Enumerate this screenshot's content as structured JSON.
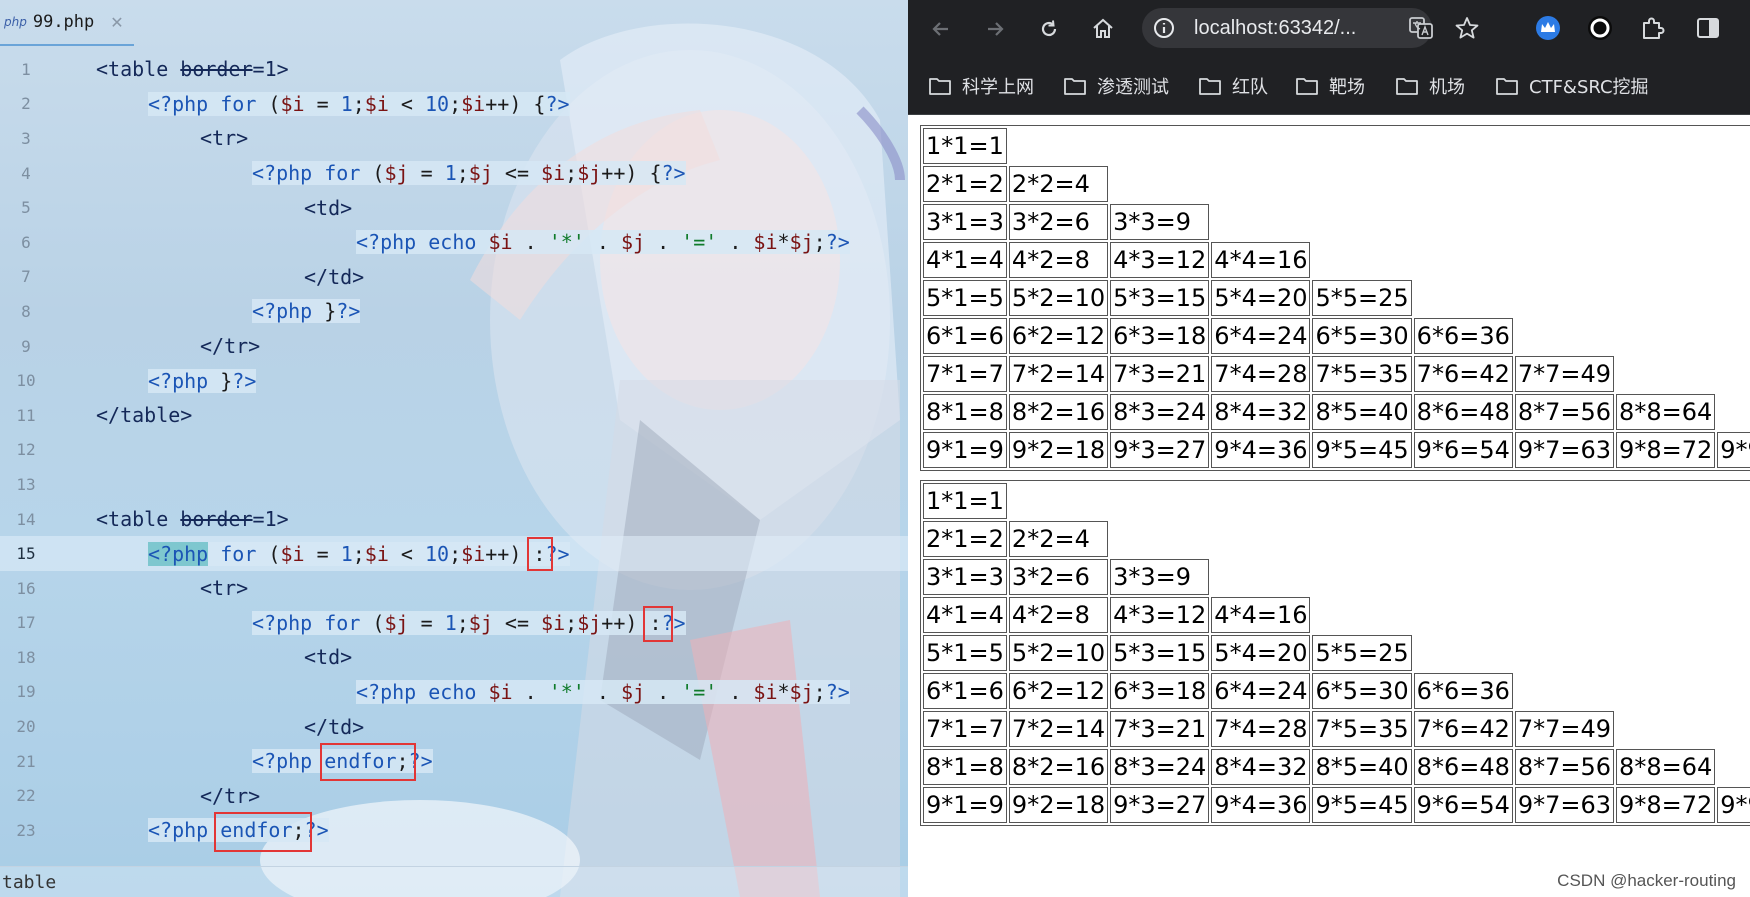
{
  "editor": {
    "file_icon": "php",
    "tab_name": "99.php",
    "close_glyph": "✕",
    "breadcrumb": "table",
    "line_numbers": [
      "1",
      "2",
      "3",
      "4",
      "5",
      "6",
      "7",
      "8",
      "9",
      "10",
      "11",
      "12",
      "13",
      "14",
      "15",
      "16",
      "17",
      "18",
      "19",
      "20",
      "21",
      "22",
      "23"
    ],
    "code": {
      "l1": {
        "t": "<table ",
        "attr": "border",
        "rest": "=1>"
      },
      "l2": {
        "open": "<?php ",
        "kw": "for",
        "a": " (",
        "v1": "$i",
        "b": " = ",
        "n1": "1",
        "c": ";",
        "v2": "$i",
        "d": " < ",
        "n2": "10",
        "e": ";",
        "v3": "$i",
        "f": "++) {",
        "close": "?>"
      },
      "l3": "<tr>",
      "l4": {
        "open": "<?php ",
        "kw": "for",
        "a": " (",
        "v1": "$j",
        "b": " = ",
        "n1": "1",
        "c": ";",
        "v2": "$j",
        "d": " <= ",
        "v3": "$i",
        "e": ";",
        "v4": "$j",
        "f": "++) {",
        "close": "?>"
      },
      "l5": "<td>",
      "l6": {
        "open": "<?php ",
        "kw": "echo",
        "sp": " ",
        "v1": "$i",
        "a": " . ",
        "s1": "'*'",
        "b": " . ",
        "v2": "$j",
        "c": " . ",
        "s2": "'='",
        "d": " . ",
        "v3": "$i",
        "e": "*",
        "v4": "$j",
        "f": ";",
        "close": "?>"
      },
      "l7": "</td>",
      "l8": {
        "open": "<?php ",
        "body": "}",
        "close": "?>"
      },
      "l9": "</tr>",
      "l10": {
        "open": "<?php ",
        "body": "}",
        "close": "?>"
      },
      "l11": "</table>",
      "l14": {
        "t": "<table ",
        "attr": "border",
        "rest": "=1>"
      },
      "l15": {
        "open": "<?php",
        "sp": " ",
        "kw": "for",
        "a": " (",
        "v1": "$i",
        "b": " = ",
        "n1": "1",
        "c": ";",
        "v2": "$i",
        "d": " < ",
        "n2": "10",
        "e": ";",
        "v3": "$i",
        "f": "++) ",
        "colon": ":",
        "close": "?>"
      },
      "l16": "<tr>",
      "l17": {
        "open": "<?php ",
        "kw": "for",
        "a": " (",
        "v1": "$j",
        "b": " = ",
        "n1": "1",
        "c": ";",
        "v2": "$j",
        "d": " <= ",
        "v3": "$i",
        "e": ";",
        "v4": "$j",
        "f": "++) ",
        "colon": ":",
        "close": "?>"
      },
      "l18": "<td>",
      "l19": {
        "open": "<?php ",
        "kw": "echo",
        "sp": " ",
        "v1": "$i",
        "a": " . ",
        "s1": "'*'",
        "b": " . ",
        "v2": "$j",
        "c": " . ",
        "s2": "'='",
        "d": " . ",
        "v3": "$i",
        "e": "*",
        "v4": "$j",
        "f": ";",
        "close": "?>"
      },
      "l20": "</td>",
      "l21": {
        "open": "<?php ",
        "kw": "endfor",
        "semi": ";",
        "close": "?>"
      },
      "l22": "</tr>",
      "l23": {
        "open": "<?php ",
        "kw": "endfor",
        "semi": ";",
        "close": "?>"
      }
    }
  },
  "browser": {
    "url": "localhost:63342/...",
    "bookmarks": [
      "科学上网",
      "渗透测试",
      "红队",
      "靶场",
      "机场",
      "CTF&SRC挖掘"
    ],
    "watermark": "CSDN @hacker-routing",
    "colors": {
      "toolbar_bg": "#202124",
      "highlight_box": "#e23636"
    }
  }
}
